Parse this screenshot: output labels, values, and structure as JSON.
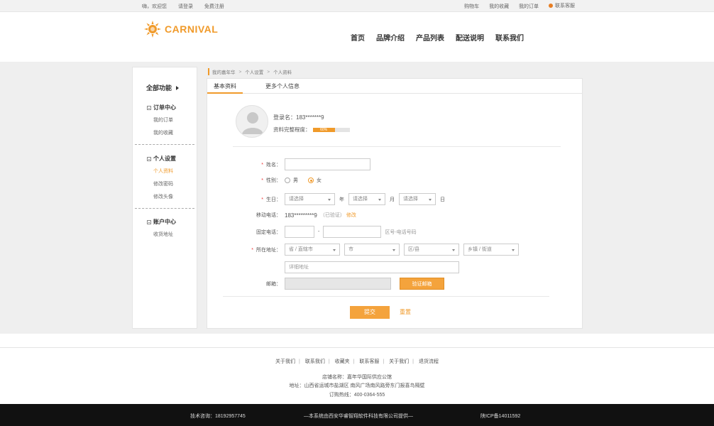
{
  "topbar": {
    "greeting": "嗨，欢迎您",
    "login": "请登录",
    "register": "免费注册",
    "cart": "购物车",
    "favorites": "我的收藏",
    "orders": "我的订单",
    "customer_service": "联系客服"
  },
  "header": {
    "logo_text": "CARNIVAL",
    "nav": [
      "首页",
      "品牌介绍",
      "产品列表",
      "配送说明",
      "联系我们"
    ]
  },
  "breadcrumb": [
    "我的嘉年华",
    "个人设置",
    "个人资料"
  ],
  "sidebar": {
    "title": "全部功能",
    "groups": [
      {
        "title": "订单中心",
        "items": [
          "我的订单",
          "我的收藏"
        ]
      },
      {
        "title": "个人设置",
        "items": [
          "个人资料",
          "修改密码",
          "修改头像"
        ]
      },
      {
        "title": "账户中心",
        "items": [
          "收货地址"
        ]
      }
    ]
  },
  "tabs": [
    "基本资料",
    "更多个人信息"
  ],
  "profile": {
    "login_name_label": "登录名：",
    "login_name": "183*******9",
    "completeness_label": "资料完整程度：",
    "completeness_value": "60%",
    "completeness_fraction": 0.6
  },
  "form": {
    "name_label": "姓名：",
    "gender_label": "性别：",
    "gender_male": "男",
    "gender_female": "女",
    "birthday_label": "生日：",
    "select_placeholder": "请选择",
    "year": "年",
    "month": "月",
    "day": "日",
    "mobile_label": "移动电话：",
    "mobile": "183*********9",
    "verified": "（已验证）",
    "modify": "修改",
    "phone_label": "固定电话：",
    "phone_dash": "-",
    "phone_hint": "区号-电话号码",
    "address_label": "所在地址：",
    "province": "省 / 直辖市",
    "city": "市",
    "district": "区/县",
    "town": "乡镇 / 街道",
    "detail_address": "详细地址",
    "email_label": "邮箱：",
    "verify_email": "验证邮箱",
    "submit": "提交",
    "reset": "重置"
  },
  "footer": {
    "links": [
      "关于我们",
      "联系我们",
      "收藏夹",
      "联系客服",
      "关于我们",
      "退货流程"
    ],
    "store": "店铺名称：嘉年华国际供应公馆",
    "address": "地址：山西省运城市盐湖区 南风广场南风路旁东门报喜鸟隔壁",
    "hotline": "订购热线：400-0364-555",
    "tech": "技术咨询：18192957745",
    "provider": "—本系统由西安华睿智翔软件科技有限公司提供—",
    "icp": "陕ICP备14011592"
  },
  "colors": {
    "accent": "#f09a2a",
    "footer_bg": "#111111"
  }
}
